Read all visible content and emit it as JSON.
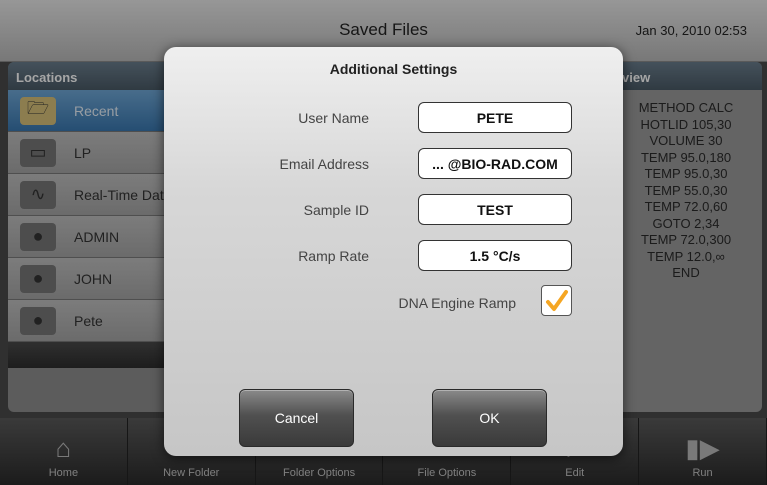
{
  "titlebar": {
    "title": "Saved Files",
    "datetime": "Jan 30, 2010 02:53"
  },
  "locations": {
    "header": "Locations",
    "items": [
      {
        "label": "Recent",
        "icon": "open-folder-icon",
        "selected": true
      },
      {
        "label": "LP",
        "icon": "usb-drive-icon"
      },
      {
        "label": "Real-Time Data",
        "icon": "real-time-data-icon"
      },
      {
        "label": "ADMIN",
        "icon": "admin-user-icon"
      },
      {
        "label": "JOHN",
        "icon": "user-icon"
      },
      {
        "label": "Pete",
        "icon": "user-icon"
      }
    ],
    "scroll_icon": "chevron-down-icon"
  },
  "preview": {
    "header": "view",
    "lines": [
      "METHOD CALC",
      "HOTLID 105,30",
      "VOLUME 30",
      "TEMP 95.0,180",
      "TEMP 95.0,30",
      "TEMP 55.0,30",
      "TEMP 72.0,60",
      "GOTO 2,34",
      "TEMP 72.0,300",
      "TEMP 12.0,∞",
      "END"
    ]
  },
  "toolbar": {
    "items": [
      {
        "label": "Home",
        "icon": "home-icon"
      },
      {
        "label": "New Folder",
        "icon": "new-folder-icon"
      },
      {
        "label": "Folder Options",
        "icon": "folder-options-icon"
      },
      {
        "label": "File Options",
        "icon": "file-options-icon"
      },
      {
        "label": "Edit",
        "icon": "edit-icon"
      },
      {
        "label": "Run",
        "icon": "run-icon"
      }
    ]
  },
  "dialog": {
    "title": "Additional Settings",
    "fields": {
      "user_name": {
        "label": "User Name",
        "value": "PETE"
      },
      "email": {
        "label": "Email Address",
        "value": "... @BIO-RAD.COM"
      },
      "sample_id": {
        "label": "Sample ID",
        "value": "TEST"
      },
      "ramp_rate": {
        "label": "Ramp Rate",
        "value": "1.5 °C/s"
      }
    },
    "dna_engine_ramp": {
      "label": "DNA Engine Ramp",
      "checked": true,
      "check_color": "#f5a623"
    },
    "cancel_label": "Cancel",
    "ok_label": "OK"
  }
}
